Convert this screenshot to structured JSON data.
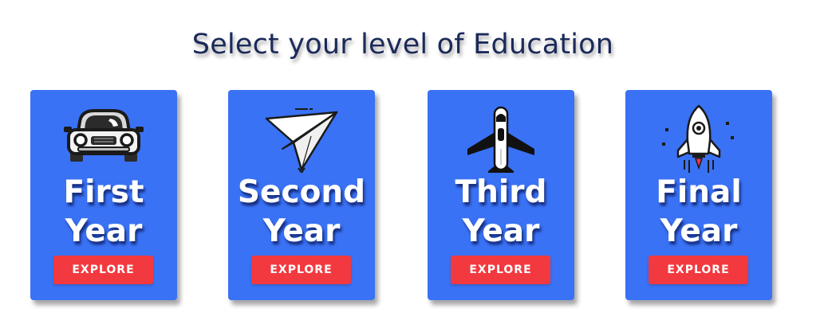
{
  "heading": "Select your level of Education",
  "cards": [
    {
      "line1": "First",
      "line2": "Year",
      "button": "EXPLORE",
      "icon": "car-icon"
    },
    {
      "line1": "Second",
      "line2": "Year",
      "button": "EXPLORE",
      "icon": "paper-plane-icon"
    },
    {
      "line1": "Third",
      "line2": "Year",
      "button": "EXPLORE",
      "icon": "airplane-icon"
    },
    {
      "line1": "Final",
      "line2": "Year",
      "button": "EXPLORE",
      "icon": "rocket-icon"
    }
  ],
  "colors": {
    "heading": "#1b2a59",
    "card": "#3a72f5",
    "button": "#f2393f"
  }
}
